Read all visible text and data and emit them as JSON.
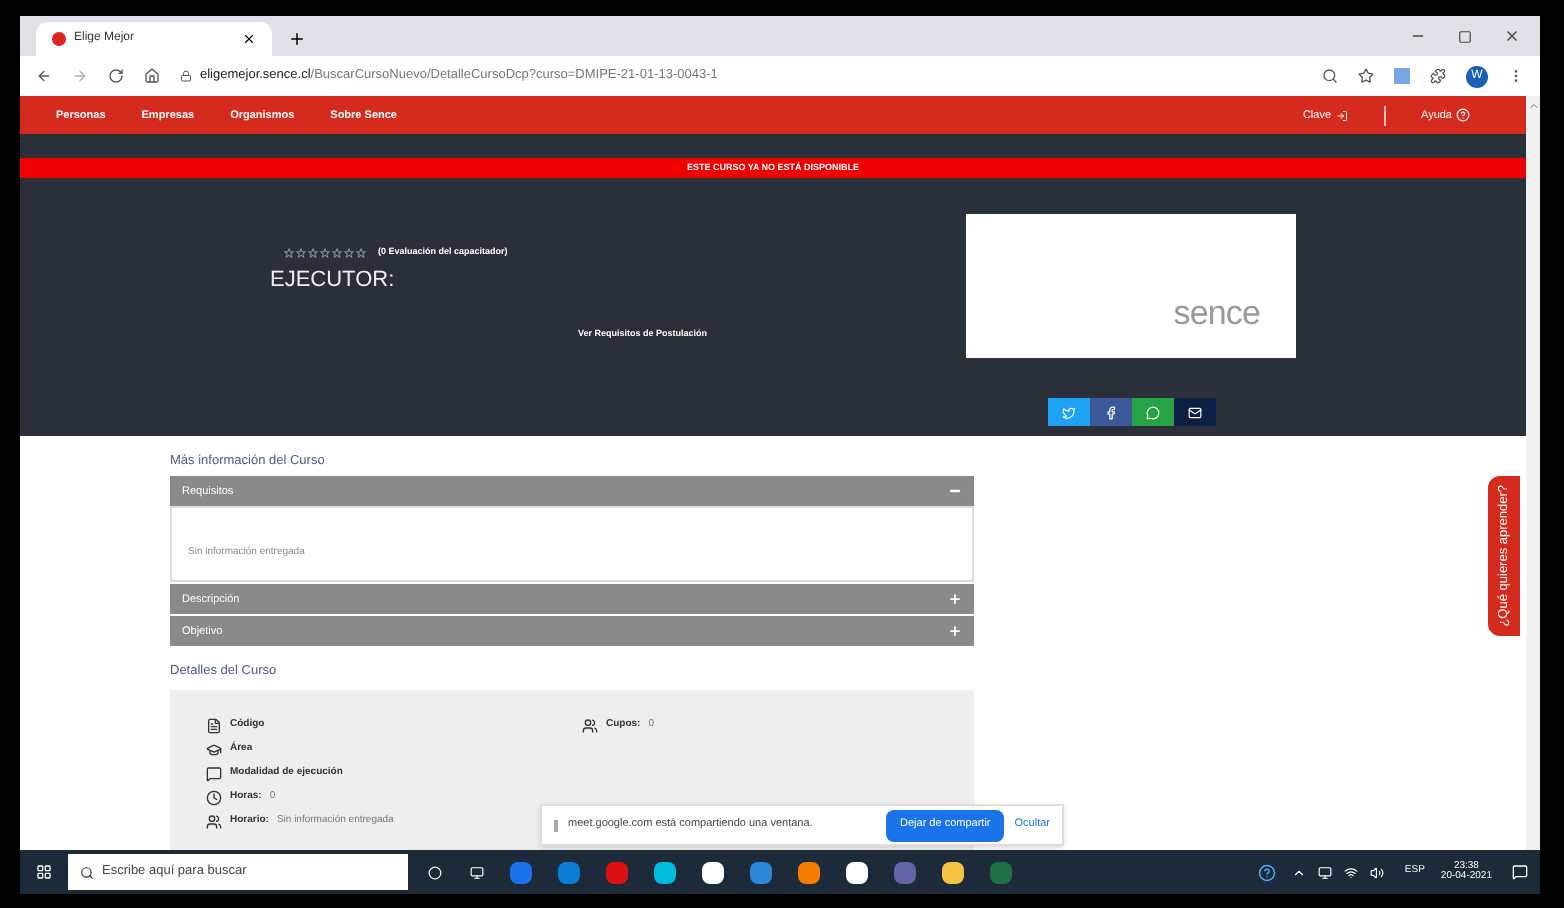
{
  "browser": {
    "tab_title": "Elige Mejor",
    "url_host": "eligemejor.sence.cl",
    "url_path": "/BuscarCursoNuevo/DetalleCursoDcp?curso=DMIPE-21-01-13-0043-1",
    "profile_initial": "W"
  },
  "nav": {
    "items": [
      "Personas",
      "Empresas",
      "Organismos",
      "Sobre Sence"
    ],
    "login": "Clave",
    "help": "Ayuda"
  },
  "banner": "ESTE CURSO YA NO ESTÁ DISPONIBLE",
  "hero": {
    "stars": 0,
    "rating_label": "(0 Evaluación del capacitador)",
    "executor": "EJECUTOR:",
    "requirements_link": "Ver Requisitos de Postulación",
    "logo_text": "sence"
  },
  "more_info": {
    "title": "Más información del Curso",
    "sections": [
      {
        "title": "Requisitos",
        "expanded": true,
        "body": "Sin información entregada"
      },
      {
        "title": "Descripción",
        "expanded": false
      },
      {
        "title": "Objetivo",
        "expanded": false
      }
    ]
  },
  "details": {
    "title": "Detalles del Curso",
    "left": [
      {
        "label": "Código"
      },
      {
        "label": "Área"
      },
      {
        "label": "Modalidad de ejecución"
      },
      {
        "label": "Horas:",
        "value": "0"
      },
      {
        "label": "Horario:",
        "value": "Sin información entregada"
      }
    ],
    "right": [
      {
        "label": "Cupos:",
        "value": "0"
      }
    ]
  },
  "side_tab": "¿Qué quieres aprender?",
  "sharing_bar": {
    "message": "meet.google.com está compartiendo una ventana.",
    "stop": "Dejar de compartir",
    "hide": "Ocultar"
  },
  "taskbar": {
    "search_placeholder": "Escribe aquí para buscar",
    "language": "ESP",
    "time": "23:38",
    "date": "20-04-2021"
  }
}
